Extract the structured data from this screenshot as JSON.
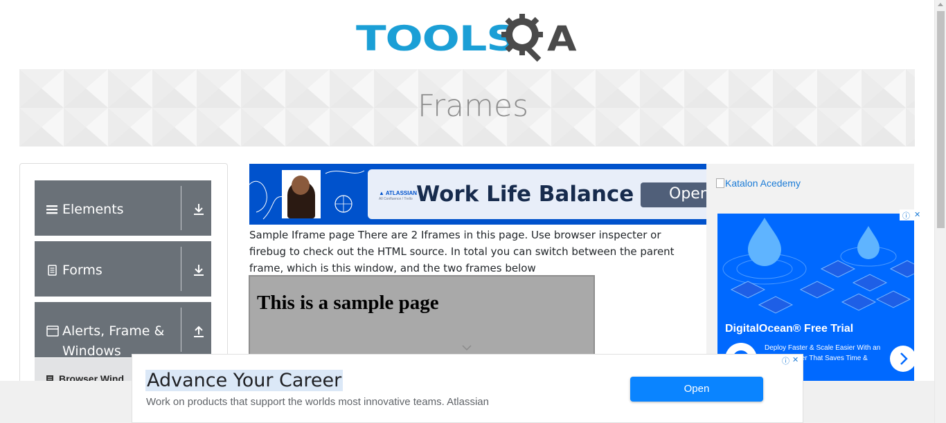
{
  "header": {
    "logo_text": "TOOLS",
    "logo_suffix": "A"
  },
  "banner": {
    "title": "Frames"
  },
  "sidebar": {
    "groups": [
      {
        "label": "Elements",
        "icon": "hamburger-icon",
        "arrow": "download-arrow-icon"
      },
      {
        "label": "Forms",
        "icon": "document-icon",
        "arrow": "download-arrow-icon"
      },
      {
        "label": "Alerts, Frame & Windows",
        "label_line1": "Alerts, Frame &",
        "label_line2": "Windows",
        "icon": "window-icon",
        "arrow": "upload-arrow-icon"
      }
    ],
    "sub_item": {
      "label": "Browser Wind",
      "icon": "document-icon"
    }
  },
  "top_ad": {
    "brand": "▲ ATLASSIAN",
    "brand_sub": "All Confluence / Trello",
    "headline": "Work Life Balance",
    "button": "Open",
    "accent": "#0052cc"
  },
  "content": {
    "description": "Sample Iframe page There are 2 Iframes in this page. Use browser inspecter or firebug to check out the HTML source. In total you can switch between the parent frame, which is this window, and the two frames below",
    "iframe_heading": "This is a sample page"
  },
  "right_col": {
    "katalon_alt": "Katalon Acedemy",
    "do_ad": {
      "title": "DigitalOcean® Free Trial",
      "body": "Deploy Faster & Scale Easier With an Ocean Server That Saves Time & Money.",
      "accent": "#0069ff"
    }
  },
  "bottom_ad": {
    "headline": "Advance Your Career",
    "sub": "Work on products that support the worlds most innovative teams. Atlassian",
    "button": "Open",
    "button_color": "#0a84ff"
  }
}
